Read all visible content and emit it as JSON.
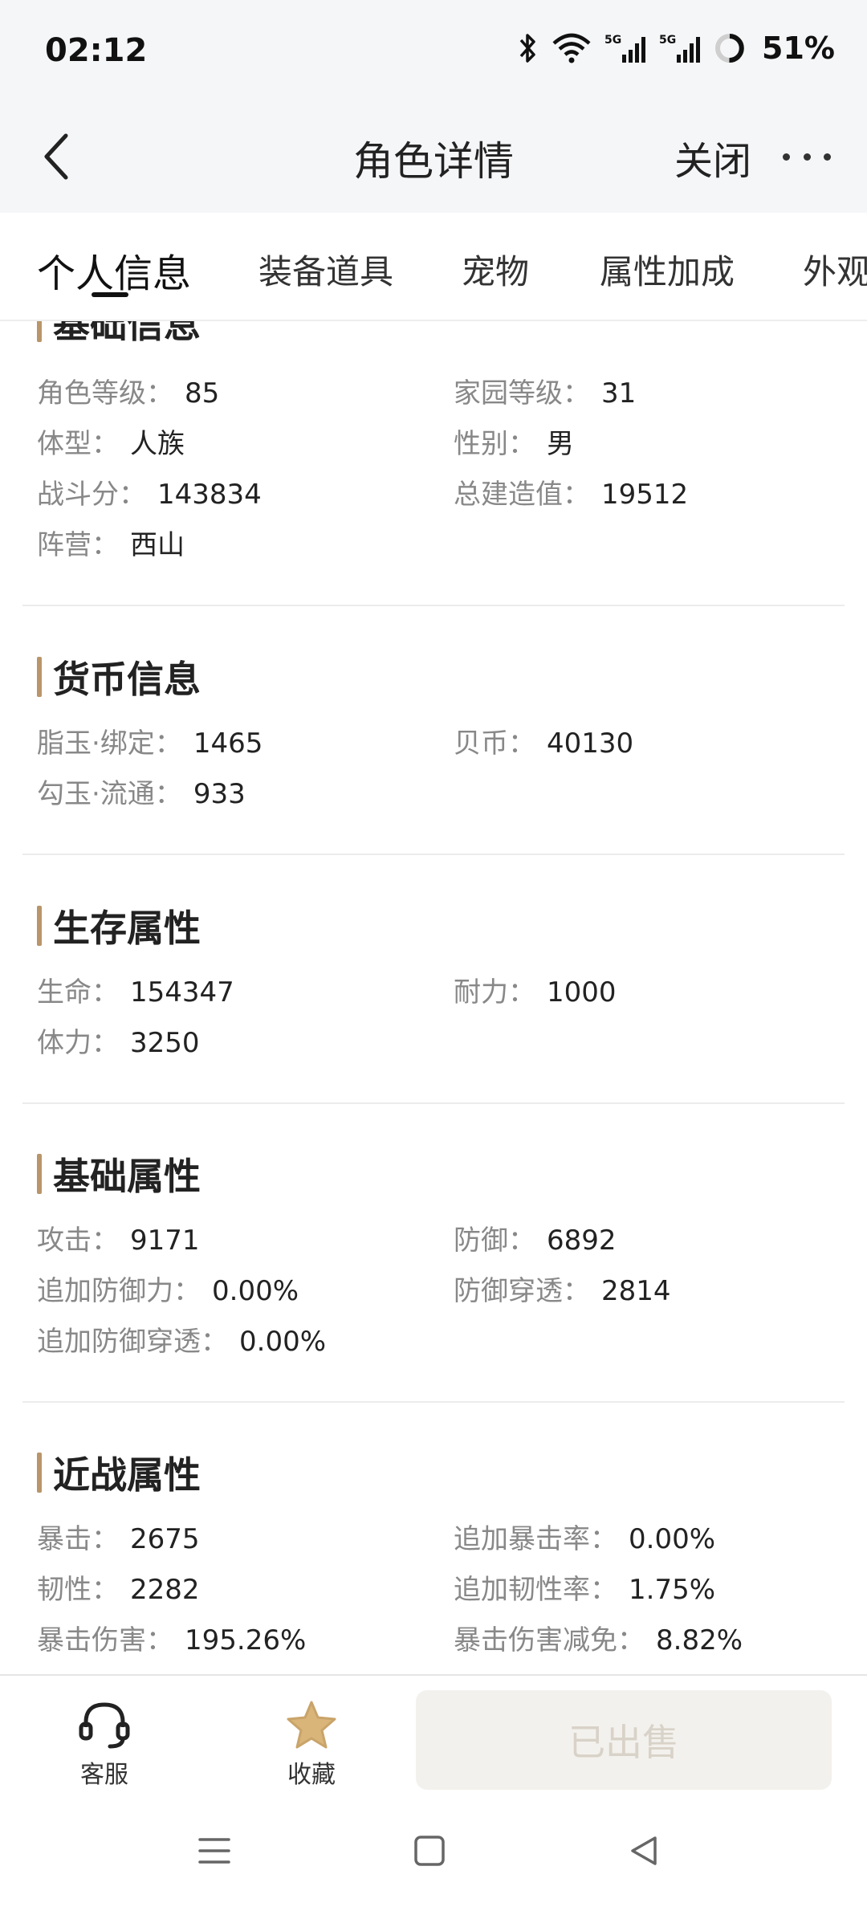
{
  "status": {
    "time": "02:12",
    "battery": "51%",
    "icons": [
      "bluetooth-icon",
      "wifi-icon",
      "5g-signal-icon",
      "5g-signal-icon",
      "battery-ring-icon"
    ]
  },
  "header": {
    "title": "角色详情",
    "close_label": "关闭"
  },
  "tabs": [
    {
      "label": "个人信息",
      "active": true
    },
    {
      "label": "装备道具",
      "active": false
    },
    {
      "label": "宠物",
      "active": false
    },
    {
      "label": "属性加成",
      "active": false
    },
    {
      "label": "外观",
      "active": false
    }
  ],
  "sections": {
    "basic_info": {
      "title": "基础信息",
      "rows": [
        {
          "label": "角色等级：",
          "value": "85"
        },
        {
          "label": "家园等级：",
          "value": "31"
        },
        {
          "label": "体型：",
          "value": "人族"
        },
        {
          "label": "性别：",
          "value": "男"
        },
        {
          "label": "战斗分：",
          "value": "143834"
        },
        {
          "label": "总建造值：",
          "value": "19512"
        },
        {
          "label": "阵营：",
          "value": "西山"
        }
      ]
    },
    "currency": {
      "title": "货币信息",
      "rows": [
        {
          "label": "脂玉·绑定：",
          "value": "1465"
        },
        {
          "label": "贝币：",
          "value": "40130"
        },
        {
          "label": "勾玉·流通：",
          "value": "933"
        }
      ]
    },
    "survival": {
      "title": "生存属性",
      "rows": [
        {
          "label": "生命：",
          "value": "154347"
        },
        {
          "label": "耐力：",
          "value": "1000"
        },
        {
          "label": "体力：",
          "value": "3250"
        }
      ]
    },
    "base_attr": {
      "title": "基础属性",
      "rows": [
        {
          "label": "攻击：",
          "value": "9171"
        },
        {
          "label": "防御：",
          "value": "6892"
        },
        {
          "label": "追加防御力：",
          "value": "0.00%"
        },
        {
          "label": "防御穿透：",
          "value": "2814"
        },
        {
          "label": "追加防御穿透：",
          "value": "0.00%"
        }
      ]
    },
    "melee": {
      "title": "近战属性",
      "rows": [
        {
          "label": "暴击：",
          "value": "2675"
        },
        {
          "label": "追加暴击率：",
          "value": "0.00%"
        },
        {
          "label": "韧性：",
          "value": "2282"
        },
        {
          "label": "追加韧性率：",
          "value": "1.75%"
        },
        {
          "label": "暴击伤害：",
          "value": "195.26%"
        },
        {
          "label": "暴击伤害减免：",
          "value": "8.82%"
        }
      ]
    }
  },
  "bottom": {
    "service_label": "客服",
    "favorite_label": "收藏",
    "sold_label": "已出售"
  },
  "colors": {
    "accent": "#b8956a",
    "favorite_star": "#d9b57a",
    "sold_bg": "#f3f1ed"
  }
}
